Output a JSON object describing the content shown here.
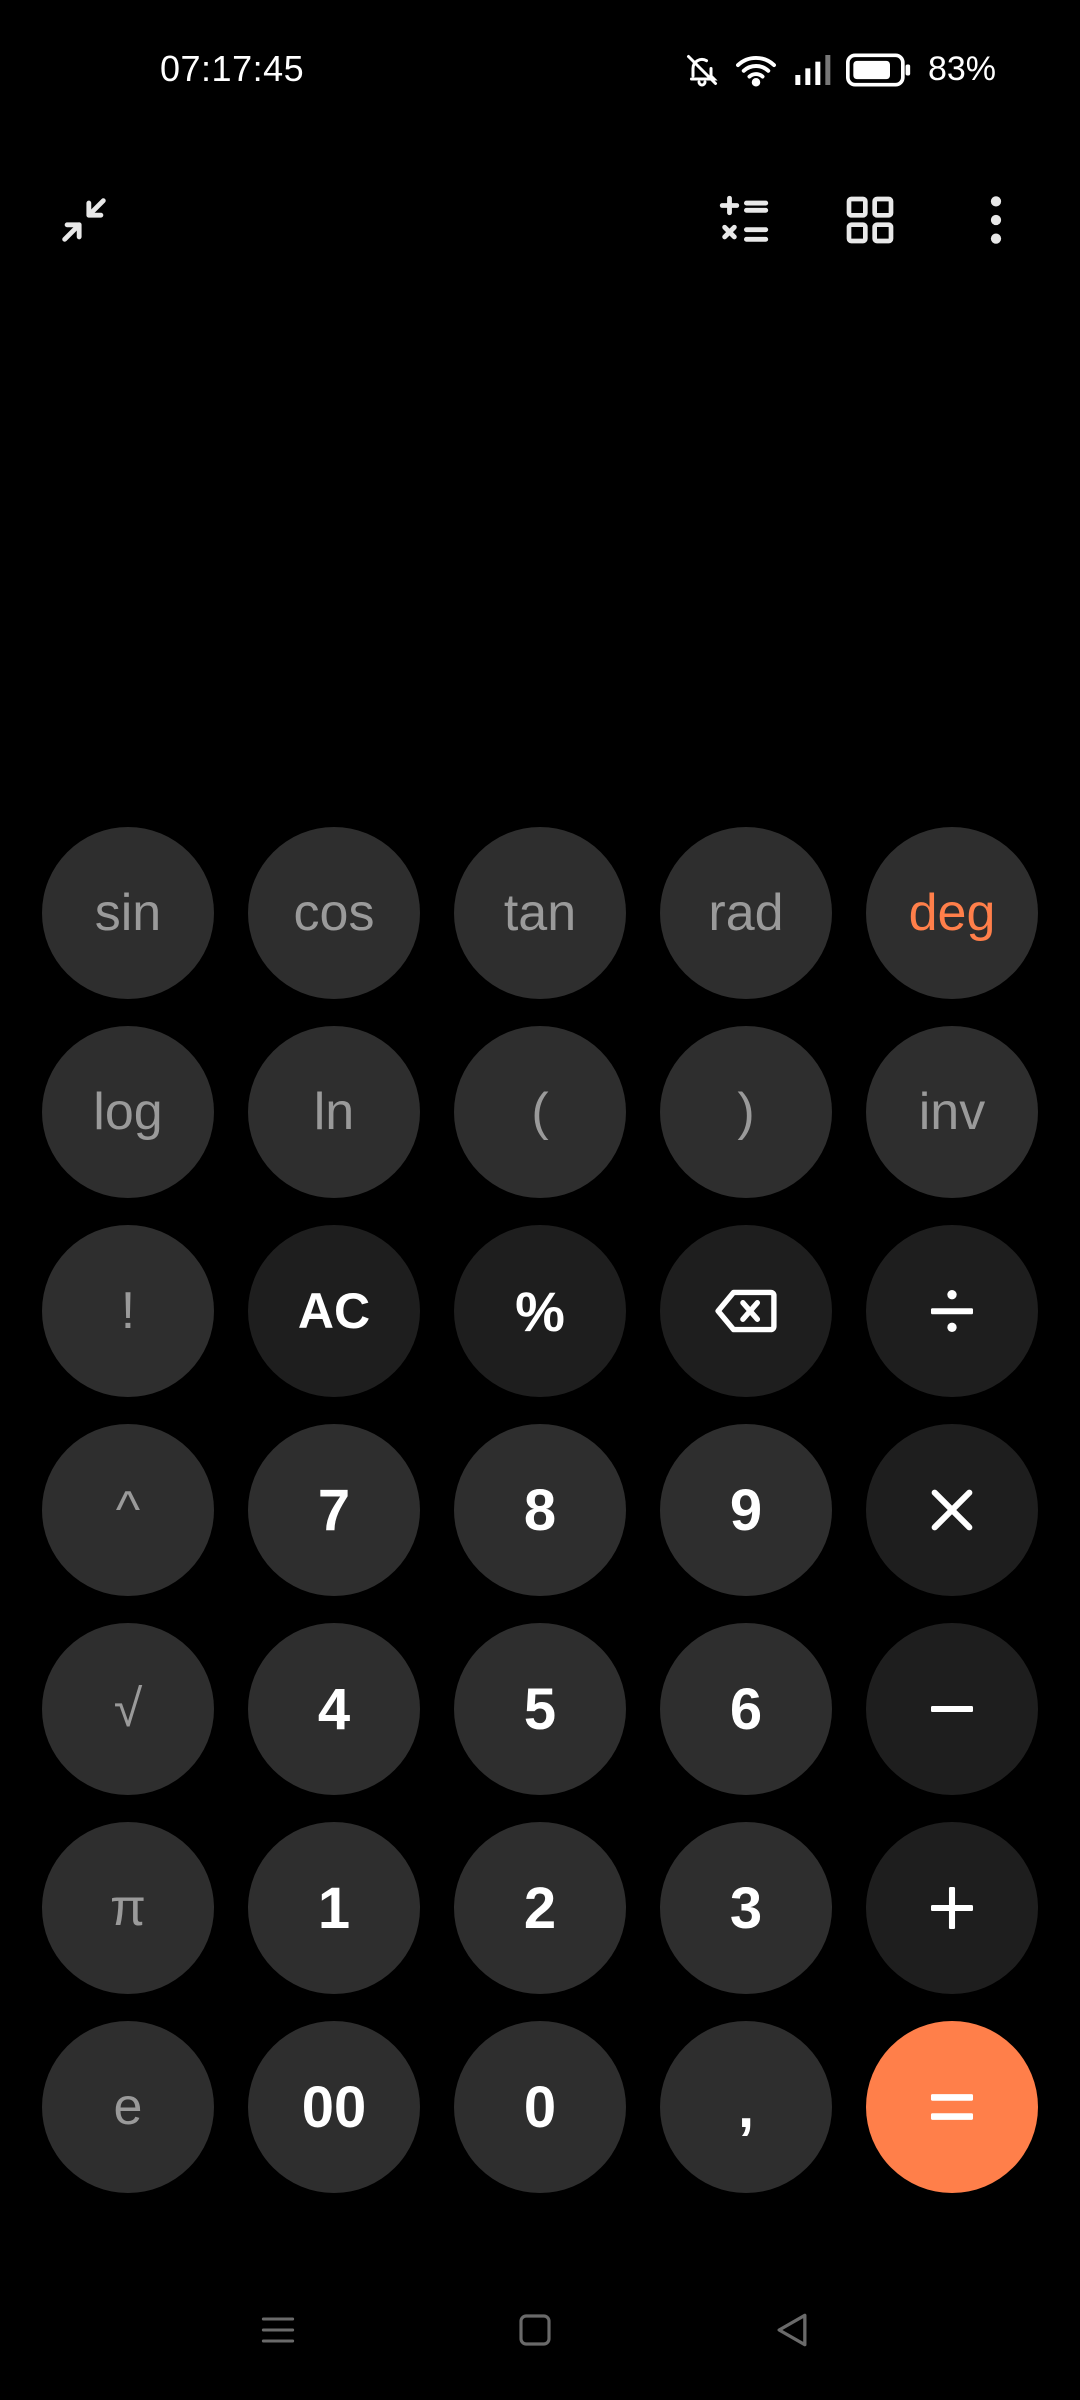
{
  "status_bar": {
    "time": "07:17:45",
    "battery_percent": "83%",
    "icons": [
      "bell-muted-icon",
      "wifi-icon",
      "signal-icon",
      "battery-icon"
    ]
  },
  "toolbar": {
    "icons": [
      "collapse-icon",
      "unit-converter-icon",
      "grid-icon",
      "more-vert-icon"
    ]
  },
  "display": {
    "expression": "",
    "result": ""
  },
  "keypad": {
    "rows": [
      [
        "sin",
        "cos",
        "tan",
        "rad",
        "deg"
      ],
      [
        "log",
        "ln",
        "(",
        ")",
        "inv"
      ],
      [
        "!",
        "AC",
        "%",
        "backspace",
        "÷"
      ],
      [
        "^",
        "7",
        "8",
        "9",
        "×"
      ],
      [
        "√",
        "4",
        "5",
        "6",
        "−"
      ],
      [
        "π",
        "1",
        "2",
        "3",
        "+"
      ],
      [
        "e",
        "00",
        "0",
        ",",
        "="
      ]
    ],
    "active_angle_mode": "deg"
  },
  "nav_bar": {
    "icons": [
      "menu-icon",
      "home-icon",
      "back-icon"
    ]
  },
  "colors": {
    "background": "#000000",
    "key_light": "#2e2e2e",
    "key_dark": "#1e1e1e",
    "sci_text": "#9a9a9a",
    "accent": "#ff7f4a"
  }
}
